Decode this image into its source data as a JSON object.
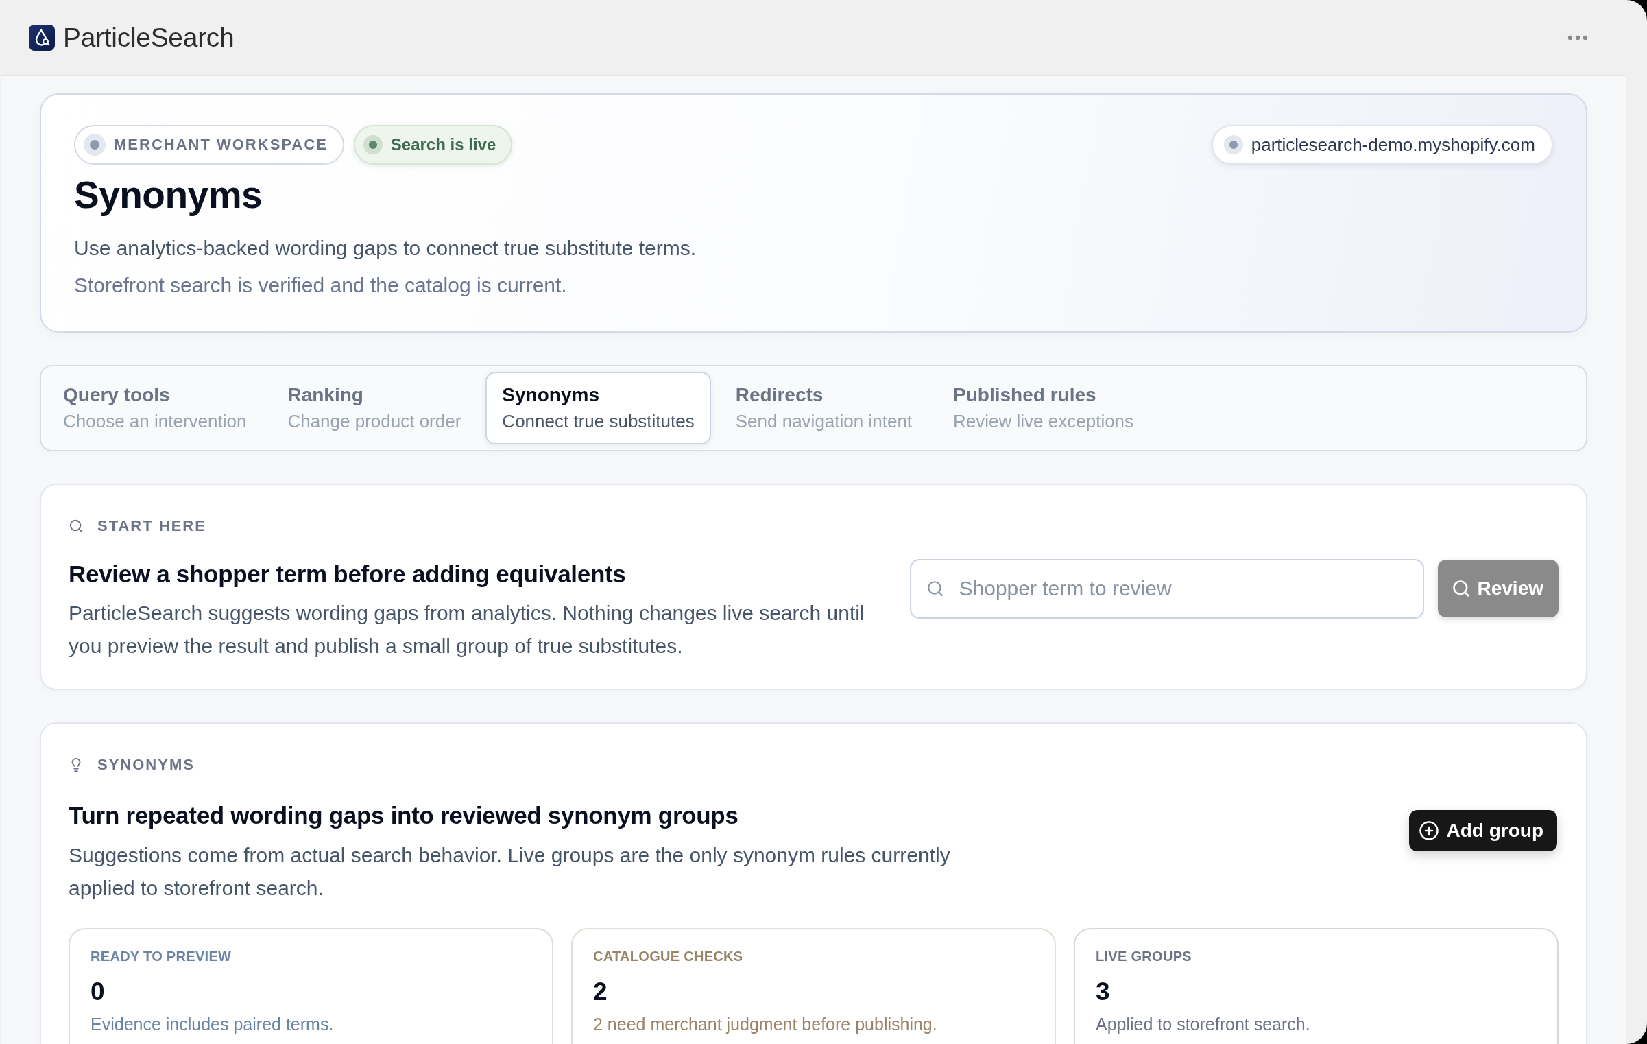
{
  "header": {
    "app_name": "ParticleSearch"
  },
  "hero": {
    "badges": [
      {
        "kind": "workspace",
        "label": "MERCHANT WORKSPACE"
      },
      {
        "kind": "live",
        "label": "Search is live"
      }
    ],
    "store_domain": "particlesearch-demo.myshopify.com",
    "title": "Synonyms",
    "description": "Use analytics-backed wording gaps to connect true substitute terms.",
    "status_note": "Storefront search is verified and the catalog is current."
  },
  "tabs": [
    {
      "label": "Query tools",
      "subtitle": "Choose an intervention",
      "selected": false
    },
    {
      "label": "Ranking",
      "subtitle": "Change product order",
      "selected": false
    },
    {
      "label": "Synonyms",
      "subtitle": "Connect true substitutes",
      "selected": true
    },
    {
      "label": "Redirects",
      "subtitle": "Send navigation intent",
      "selected": false
    },
    {
      "label": "Published rules",
      "subtitle": "Review live exceptions",
      "selected": false
    }
  ],
  "start_panel": {
    "kicker": "START HERE",
    "heading": "Review a shopper term before adding equivalents",
    "body": "ParticleSearch suggests wording gaps from analytics. Nothing changes live search until you preview the result and publish a small group of true substitutes.",
    "search": {
      "placeholder": "Shopper term to review"
    },
    "review_button": {
      "label": "Review",
      "disabled": true
    }
  },
  "synonyms_panel": {
    "kicker": "SYNONYMS",
    "heading": "Turn repeated wording gaps into reviewed synonym groups",
    "body": "Suggestions come from actual search behavior. Live groups are the only synonym rules currently applied to storefront search.",
    "add_button": {
      "label": "Add group"
    },
    "stats": [
      {
        "label": "READY TO PREVIEW",
        "value": "0",
        "note": "Evidence includes paired terms.",
        "color": "#6b84a3"
      },
      {
        "label": "CATALOGUE CHECKS",
        "value": "2",
        "note": "2 need merchant judgment before publishing.",
        "color": "#9a8468"
      },
      {
        "label": "LIVE GROUPS",
        "value": "3",
        "note": "Applied to storefront search.",
        "color": "#6b7385"
      }
    ]
  }
}
